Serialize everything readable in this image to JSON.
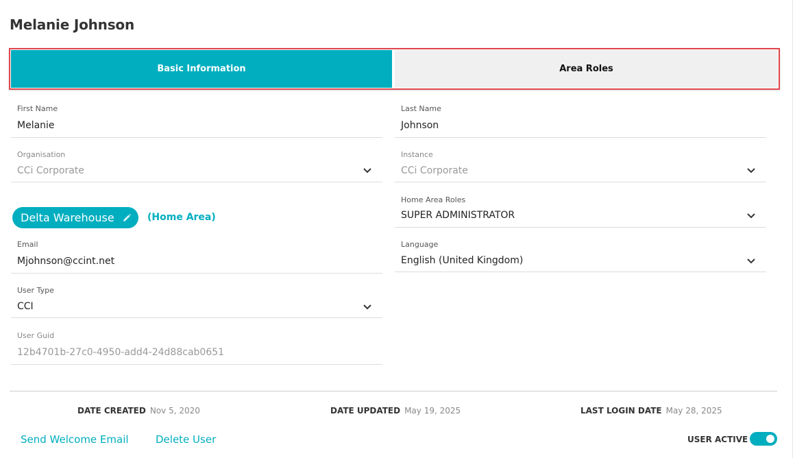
{
  "page": {
    "title": "Melanie Johnson"
  },
  "tabs": [
    {
      "label": "Basic Information",
      "active": true
    },
    {
      "label": "Area Roles",
      "active": false
    }
  ],
  "form": {
    "first_name": {
      "label": "First Name",
      "value": "Melanie"
    },
    "last_name": {
      "label": "Last Name",
      "value": "Johnson"
    },
    "organisation": {
      "label": "Organisation",
      "value": "CCi Corporate"
    },
    "instance": {
      "label": "Instance",
      "value": "CCi Corporate"
    },
    "home_area": {
      "chip_label": "Delta Warehouse",
      "tag": "(Home Area)"
    },
    "home_area_roles": {
      "label": "Home Area Roles",
      "value": "SUPER ADMINISTRATOR"
    },
    "email": {
      "label": "Email",
      "value": "Mjohnson@ccint.net"
    },
    "language": {
      "label": "Language",
      "value": "English (United Kingdom)"
    },
    "user_type": {
      "label": "User Type",
      "value": "CCI"
    },
    "user_guid": {
      "label": "User Guid",
      "value": "12b4701b-27c0-4950-add4-24d88cab0651"
    }
  },
  "meta": {
    "date_created": {
      "label": "DATE CREATED",
      "value": "Nov 5, 2020"
    },
    "date_updated": {
      "label": "DATE UPDATED",
      "value": "May 19, 2025"
    },
    "last_login": {
      "label": "LAST LOGIN DATE",
      "value": "May 28, 2025"
    }
  },
  "actions": {
    "send_welcome_email": "Send Welcome Email",
    "delete_user": "Delete User",
    "user_active_label": "USER ACTIVE",
    "user_active": true
  },
  "colors": {
    "accent": "#00aebf",
    "highlight_border": "#e0454b",
    "inactive_tab": "#f0f0f0"
  },
  "icons": {
    "dropdown": "chevron-down-icon",
    "edit": "pencil-icon"
  }
}
